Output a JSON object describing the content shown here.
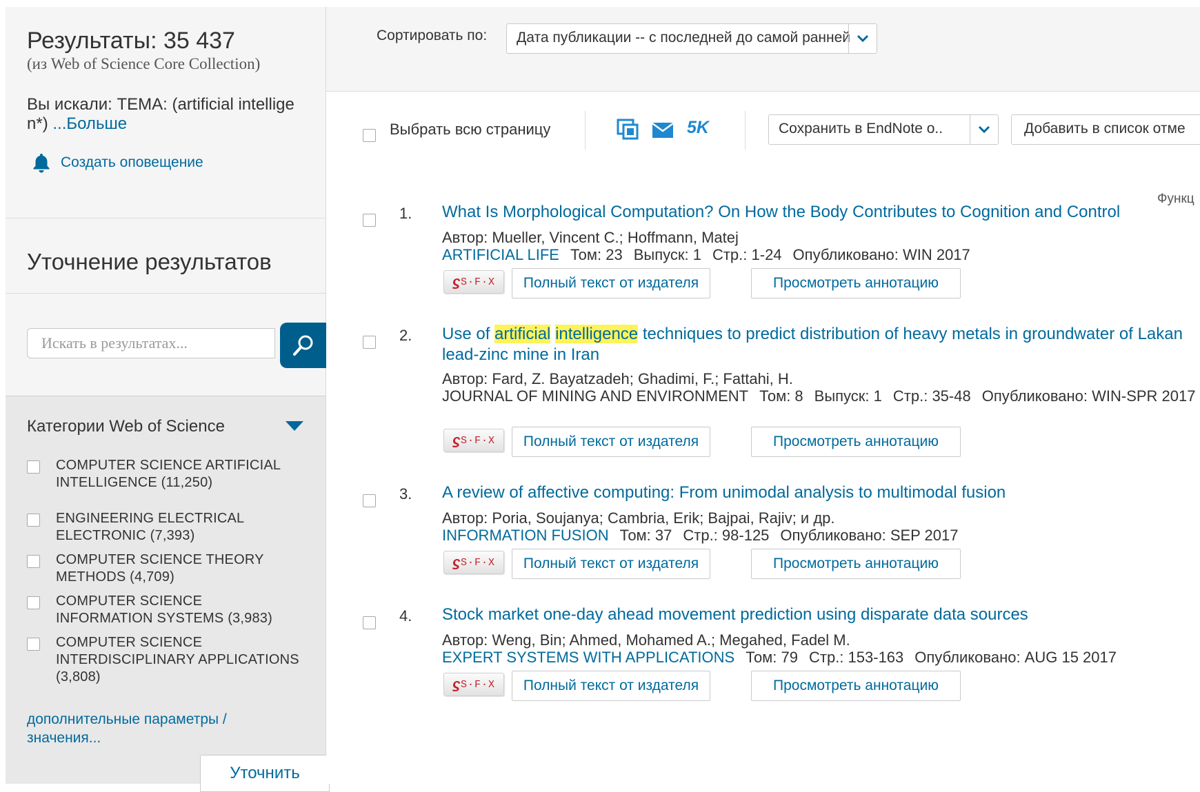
{
  "sidebar": {
    "results_title": "Результаты: 35 437",
    "results_db": "(из Web of Science Core Collection)",
    "searched_prefix": "Вы искали: TEMA: (artificial intellige n*)",
    "more_link": "...Больше",
    "create_alert": "Создать оповещение",
    "refine_heading": "Уточнение результатов",
    "search_placeholder": "Искать в результатах...",
    "categories_heading": "Категории Web of Science",
    "categories": [
      "COMPUTER SCIENCE ARTIFICIAL INTELLIGENCE (11,250)",
      "ENGINEERING ELECTRICAL ELECTRONIC (7,393)",
      "COMPUTER SCIENCE THEORY METHODS (4,709)",
      "COMPUTER SCIENCE INFORMATION SYSTEMS (3,983)",
      "COMPUTER SCIENCE INTERDISCIPLINARY APPLICATIONS (3,808)"
    ],
    "more_params": "дополнительные параметры / значения...",
    "refine_button": "Уточнить"
  },
  "sort": {
    "label": "Сортировать по:",
    "value": "Дата публикации -- с последней до самой ранней"
  },
  "toolbar": {
    "select_all": "Выбрать всю страницу",
    "fivek": "5K",
    "endnote": "Сохранить в EndNote o..",
    "add_to_marked": "Добавить в список отме",
    "functions_cut": "Функц"
  },
  "colors": {
    "link": "#006a9d",
    "highlight": "#fff35a",
    "search_button": "#005e8c",
    "fivek": "#1e88d0",
    "sfx_red": "#c5202b"
  },
  "records": [
    {
      "num": "1.",
      "title_parts": [
        "What Is Morphological Computation? On How the Body Contributes to Cognition and Control"
      ],
      "authors": "Автор: Mueller, Vincent C.; Hoffmann, Matej",
      "journal": "ARTIFICIAL LIFE",
      "meta": [
        "Том: 23",
        "Выпуск: 1",
        "Стр.: 1-24",
        "Опубликовано: WIN 2017"
      ],
      "sfx": "S·F·X",
      "fulltext": "Полный текст от издателя",
      "abstract": "Просмотреть аннотацию"
    },
    {
      "num": "2.",
      "title_parts": [
        "Use of ",
        "artificial",
        " ",
        "intelligence",
        " techniques to predict distribution of heavy metals in groundwater of Lakan lead-zinc mine in Iran"
      ],
      "authors": "Автор: Fard, Z. Bayatzadeh; Ghadimi, F.; Fattahi, H.",
      "journal": "JOURNAL OF MINING AND ENVIRONMENT",
      "meta": [
        "Том: 8",
        "Выпуск: 1",
        "Стр.: 35-48",
        "Опубликовано: WIN-SPR 2017"
      ],
      "sfx": "S·F·X",
      "fulltext": "Полный текст от издателя",
      "abstract": "Просмотреть аннотацию"
    },
    {
      "num": "3.",
      "title_parts": [
        "A review of affective computing: From unimodal analysis to multimodal fusion"
      ],
      "authors": "Автор: Poria, Soujanya; Cambria, Erik; Bajpai, Rajiv; и др.",
      "journal": "INFORMATION FUSION",
      "meta": [
        "Том: 37",
        "Стр.: 98-125",
        "Опубликовано: SEP 2017"
      ],
      "sfx": "S·F·X",
      "fulltext": "Полный текст от издателя",
      "abstract": "Просмотреть аннотацию"
    },
    {
      "num": "4.",
      "title_parts": [
        "Stock market one-day ahead movement prediction using disparate data sources"
      ],
      "authors": "Автор: Weng, Bin; Ahmed, Mohamed A.; Megahed, Fadel M.",
      "journal": "EXPERT SYSTEMS WITH APPLICATIONS",
      "meta": [
        "Том: 79",
        "Стр.: 153-163",
        "Опубликовано: AUG 15 2017"
      ],
      "sfx": "S·F·X",
      "fulltext": "Полный текст от издателя",
      "abstract": "Просмотреть аннотацию"
    }
  ]
}
